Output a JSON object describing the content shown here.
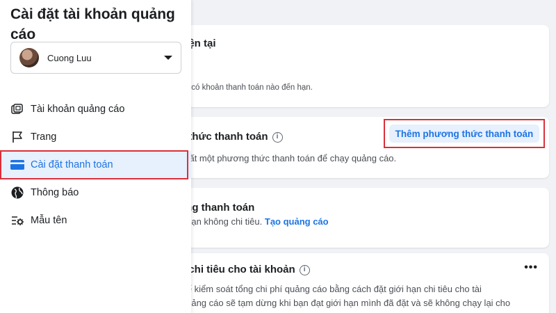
{
  "sidebar": {
    "title": "Cài đặt tài khoản quảng cáo",
    "account": {
      "name": "Cuong Luu",
      "avatar_icon": "user-avatar"
    },
    "items": [
      {
        "label": "Tài khoản quảng cáo",
        "icon": "ad-accounts-icon",
        "active": false
      },
      {
        "label": "Trang",
        "icon": "flag-icon",
        "active": false
      },
      {
        "label": "Cài đặt thanh toán",
        "icon": "credit-card-icon",
        "active": true
      },
      {
        "label": "Thông báo",
        "icon": "globe-icon",
        "active": false
      },
      {
        "label": "Mẫu tên",
        "icon": "naming-template-icon",
        "active": false
      }
    ]
  },
  "main": {
    "balance_card": {
      "title": "hiện tại",
      "text": "ưa có khoản thanh toán nào đến hạn."
    },
    "payment_methods_card": {
      "title": "g thức thanh toán",
      "info_icon": "i",
      "add_button_label": "Thêm phương thức thanh toán",
      "text": "nhất một phương thức thanh toán để chạy quảng cáo."
    },
    "payment_activity_card": {
      "title": "ộng thanh toán",
      "text": "y bạn không chi tiêu.",
      "link_label": "Tạo quảng cáo"
    },
    "spending_limit_card": {
      "title": "n chi tiêu cho tài khoản",
      "info_icon": "i",
      "more_icon": "•••",
      "line1": "thể kiểm soát tổng chi phí quảng cáo bằng cách đặt giới hạn chi tiêu cho tài",
      "line2": "Quảng cáo sẽ tạm dừng khi bạn đạt giới hạn mình đã đặt và sẽ không chạy lại cho"
    }
  },
  "colors": {
    "accent": "#1b74e4",
    "highlight_border": "#d9303a",
    "active_bg": "#e7f0fd",
    "page_bg": "#f0f2f5"
  }
}
